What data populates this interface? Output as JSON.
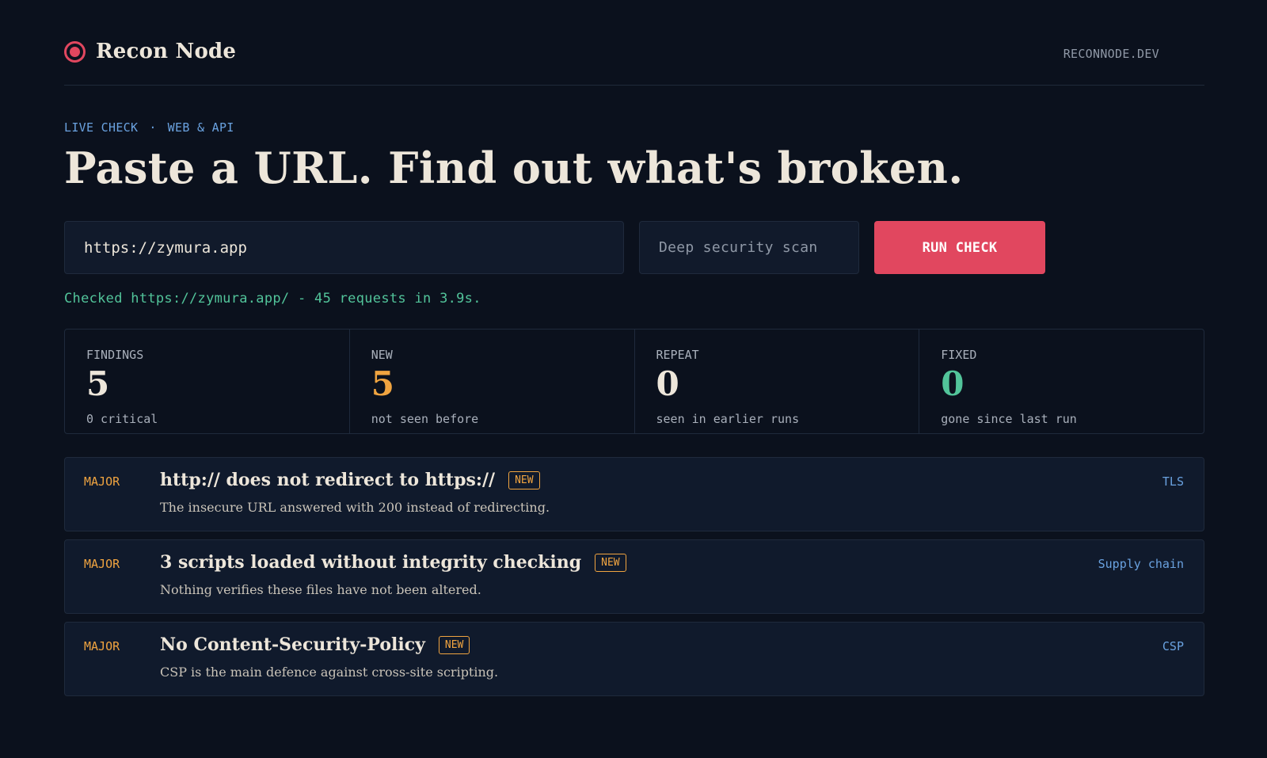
{
  "brand": {
    "name": "Recon Node",
    "domain": "RECONNODE.DEV",
    "accent": "#e1475f"
  },
  "hero": {
    "eyebrow": [
      "LIVE CHECK",
      "·",
      "WEB & API"
    ],
    "headline": "Paste a URL. Find out what's broken."
  },
  "form": {
    "url_value": "https://zymura.app",
    "mode_label": "Deep security scan",
    "run_label": "RUN CHECK"
  },
  "status": "Checked https://zymura.app/ - 45 requests in 3.9s.",
  "stats": [
    {
      "label": "FINDINGS",
      "value": "5",
      "note": "0 critical",
      "color": "#ede6da"
    },
    {
      "label": "NEW",
      "value": "5",
      "note": "not seen before",
      "color": "#f0a440"
    },
    {
      "label": "REPEAT",
      "value": "0",
      "note": "seen in earlier runs",
      "color": "#ede6da"
    },
    {
      "label": "FIXED",
      "value": "0",
      "note": "gone since last run",
      "color": "#52c49a"
    }
  ],
  "findings": [
    {
      "severity": "MAJOR",
      "title": "http:// does not redirect to https://",
      "badge": "NEW",
      "description": "The insecure URL answered with 200 instead of redirecting.",
      "category": "TLS"
    },
    {
      "severity": "MAJOR",
      "title": "3 scripts loaded without integrity checking",
      "badge": "NEW",
      "description": "Nothing verifies these files have not been altered.",
      "category": "Supply chain"
    },
    {
      "severity": "MAJOR",
      "title": "No Content-Security-Policy",
      "badge": "NEW",
      "description": "CSP is the main defence against cross-site scripting.",
      "category": "CSP"
    }
  ]
}
